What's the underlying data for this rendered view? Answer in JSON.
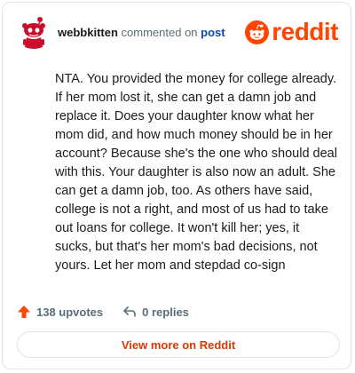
{
  "comment": {
    "username": "webbkitten",
    "action_text": "commented on",
    "target_link": "post",
    "body": "NTA. You provided the money for college already. If her mom lost it, she can get a damn job and replace it. Does your daughter know what her mom did, and how much money should be in her account? Because she's the one who should deal with this. Your daughter is also now an adult. She can get a damn job, too. As others have said, college is not a right, and most of us had to take out loans for college. It won't kill her; yes, it sucks, but that's her mom's bad decisions, not yours. Let her mom and stepdad co-sign"
  },
  "brand": {
    "name": "reddit",
    "color": "#ff4500"
  },
  "actions": {
    "upvotes": "138 upvotes",
    "replies": "0 replies"
  },
  "footer": {
    "view_more_label": "View more on Reddit"
  },
  "colors": {
    "accent": "#ff4500",
    "link": "#0a4aa6",
    "muted": "#576f76",
    "button_text": "#d93900"
  }
}
